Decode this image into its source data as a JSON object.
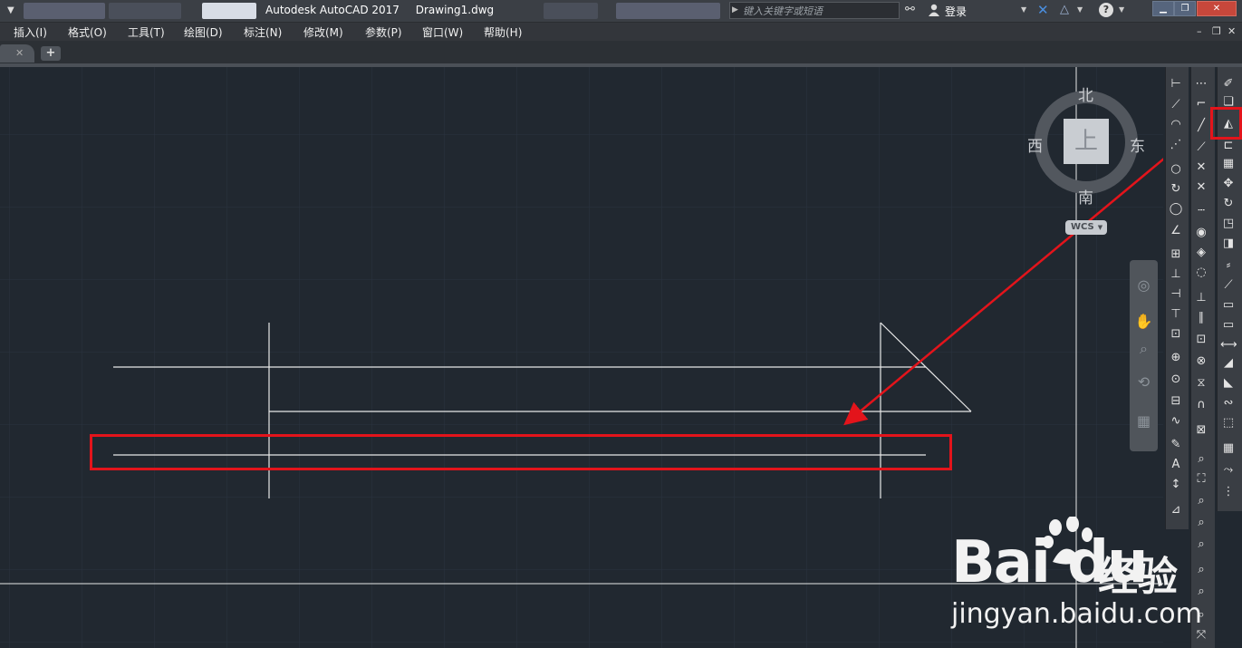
{
  "titlebar": {
    "app_title": "Autodesk AutoCAD 2017",
    "file_name": "Drawing1.dwg",
    "search_placeholder": "键入关键字或短语",
    "login_label": "登录"
  },
  "menu": {
    "items": [
      "插入(I)",
      "格式(O)",
      "工具(T)",
      "绘图(D)",
      "标注(N)",
      "修改(M)",
      "参数(P)",
      "窗口(W)",
      "帮助(H)"
    ]
  },
  "viewcube": {
    "north": "北",
    "south": "南",
    "east": "东",
    "west": "西",
    "face": "上",
    "wcs_label": "WCS"
  },
  "watermark": {
    "brand": "Bai du",
    "suffix": "经验",
    "url": "jingyan.baidu.com"
  },
  "colors": {
    "canvas_bg": "#212830",
    "highlight": "#e3141b"
  }
}
